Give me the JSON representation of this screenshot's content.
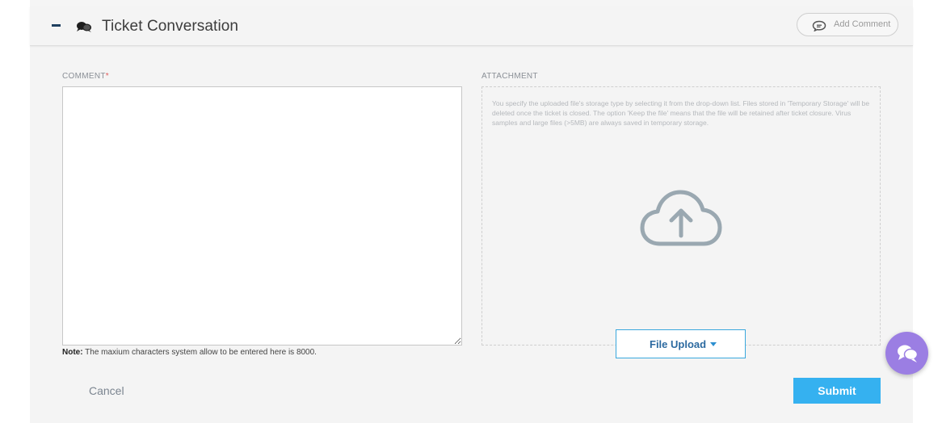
{
  "header": {
    "title": "Ticket Conversation",
    "add_comment_label": "Add Comment",
    "icons": {
      "collapse": "minus-icon",
      "section": "chat-bubbles-icon",
      "add_comment": "comment-icon"
    }
  },
  "form": {
    "comment_label": "COMMENT",
    "required_mark": "*",
    "comment_value": "",
    "attachment_label": "ATTACHMENT",
    "attachment_hint": "You specify the uploaded file's storage type by selecting it from the drop-down list. Files stored in 'Temporary Storage' will be deleted once the ticket is closed. The option 'Keep the file' means that the file will be retained after ticket closure. Virus samples and large files (>5MB) are always saved in temporary storage.",
    "note_prefix": "Note:",
    "note_text": " The maxium characters system allow to be entered here is 8000.",
    "file_upload_label": "File Upload",
    "upload_icon": "cloud-upload-icon"
  },
  "actions": {
    "cancel_label": "Cancel",
    "submit_label": "Submit"
  },
  "colors": {
    "accent": "#35b1f0",
    "chat_fab": "#9b7ee3",
    "title_text": "#3c3c3c"
  }
}
